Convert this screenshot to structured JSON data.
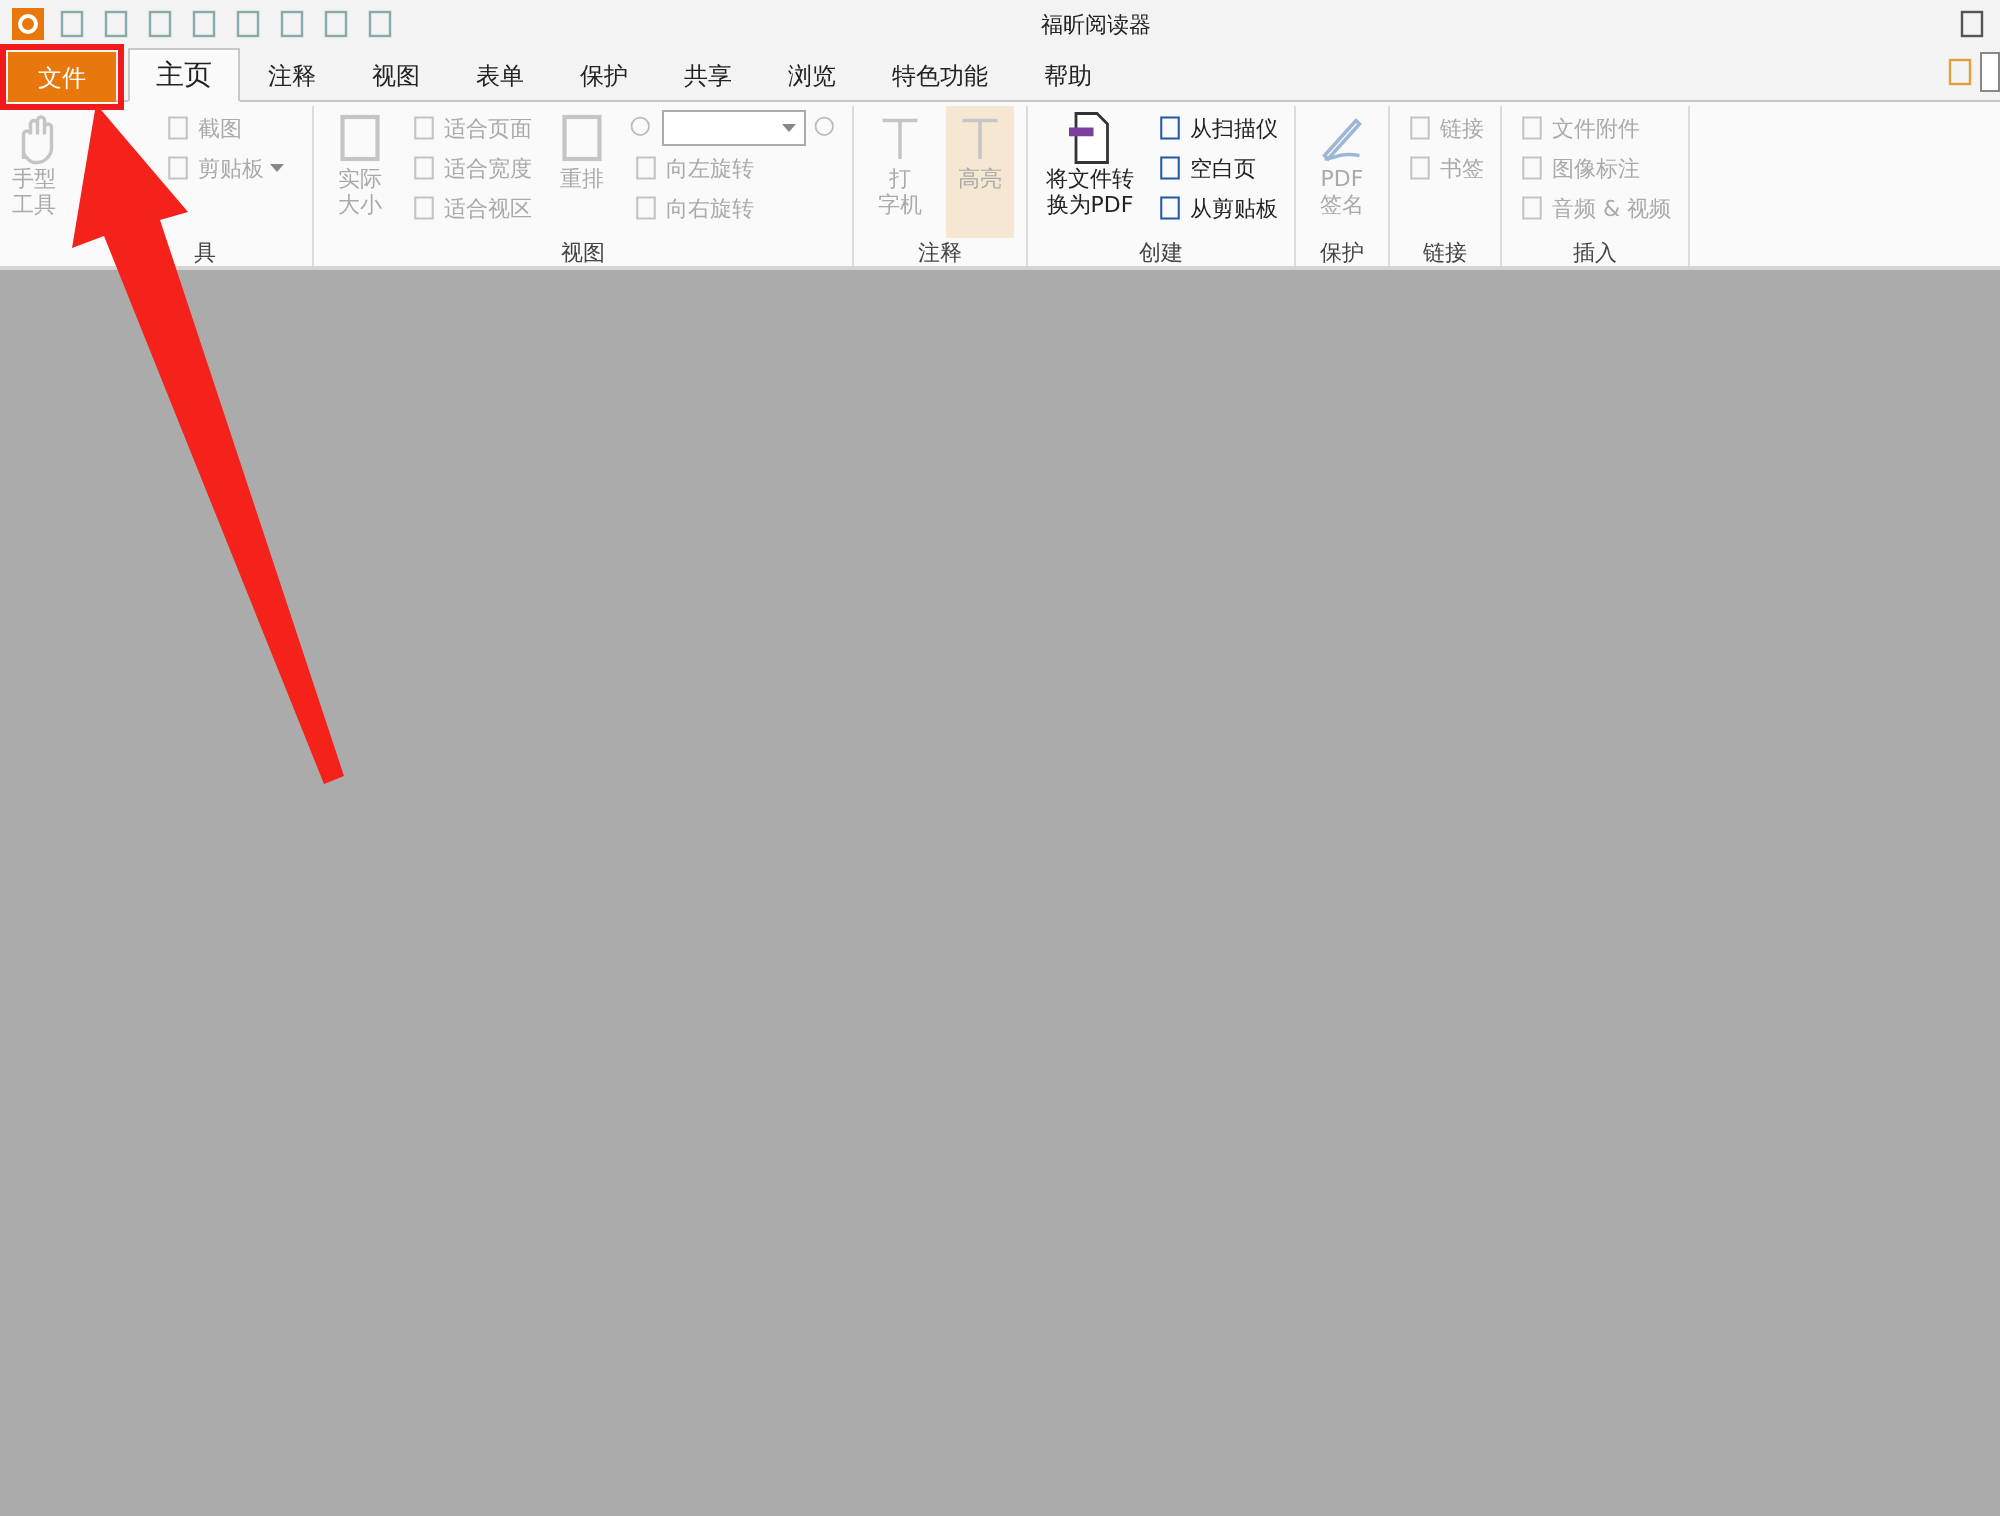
{
  "window": {
    "title": "福昕阅读器"
  },
  "tabs": [
    {
      "label": "文件",
      "kind": "file",
      "selected": false
    },
    {
      "label": "主页",
      "kind": "tab",
      "selected": true
    },
    {
      "label": "注释",
      "kind": "tab",
      "selected": false
    },
    {
      "label": "视图",
      "kind": "tab",
      "selected": false
    },
    {
      "label": "表单",
      "kind": "tab",
      "selected": false
    },
    {
      "label": "保护",
      "kind": "tab",
      "selected": false
    },
    {
      "label": "共享",
      "kind": "tab",
      "selected": false
    },
    {
      "label": "浏览",
      "kind": "tab",
      "selected": false
    },
    {
      "label": "特色功能",
      "kind": "tab",
      "selected": false
    },
    {
      "label": "帮助",
      "kind": "tab",
      "selected": false
    }
  ],
  "ribbon_groups": [
    {
      "label": "具",
      "items": [
        {
          "kind": "large",
          "lines": [
            "手型",
            "工具"
          ],
          "disabled": true
        },
        {
          "kind": "stack",
          "items": [
            {
              "label": "截图",
              "disabled": true
            },
            {
              "label": "剪贴板",
              "disabled": true
            }
          ]
        }
      ]
    },
    {
      "label": "视图",
      "items": [
        {
          "kind": "large",
          "lines": [
            "实际",
            "大小"
          ],
          "disabled": true
        },
        {
          "kind": "stack",
          "items": [
            {
              "label": "适合页面",
              "disabled": true
            },
            {
              "label": "适合宽度",
              "disabled": true
            },
            {
              "label": "适合视区",
              "disabled": true
            }
          ]
        },
        {
          "kind": "large",
          "lines": [
            "重排"
          ],
          "disabled": true
        },
        {
          "kind": "zoom",
          "items": [
            {
              "label": "向左旋转",
              "disabled": true
            },
            {
              "label": "向右旋转",
              "disabled": true
            }
          ]
        }
      ]
    },
    {
      "label": "注释",
      "items": [
        {
          "kind": "large",
          "lines": [
            "打",
            "字机"
          ],
          "disabled": true,
          "selected": false
        },
        {
          "kind": "large",
          "lines": [
            "高亮"
          ],
          "disabled": true,
          "selected": true
        }
      ]
    },
    {
      "label": "创建",
      "items": [
        {
          "kind": "large",
          "lines": [
            "将文件转",
            "换为PDF"
          ],
          "disabled": false
        },
        {
          "kind": "stack",
          "items": [
            {
              "label": "从扫描仪",
              "disabled": false
            },
            {
              "label": "空白页",
              "disabled": false
            },
            {
              "label": "从剪贴板",
              "disabled": false
            }
          ]
        }
      ]
    },
    {
      "label": "保护",
      "items": [
        {
          "kind": "large",
          "lines": [
            "PDF",
            "签名"
          ],
          "disabled": true
        }
      ]
    },
    {
      "label": "链接",
      "items": [
        {
          "kind": "stack",
          "items": [
            {
              "label": "链接",
              "disabled": true
            },
            {
              "label": "书签",
              "disabled": true
            }
          ]
        }
      ]
    },
    {
      "label": "插入",
      "items": [
        {
          "kind": "stack",
          "items": [
            {
              "label": "文件附件",
              "disabled": true
            },
            {
              "label": "图像标注",
              "disabled": true
            },
            {
              "label": "音频 & 视频",
              "disabled": true
            }
          ]
        }
      ]
    }
  ]
}
